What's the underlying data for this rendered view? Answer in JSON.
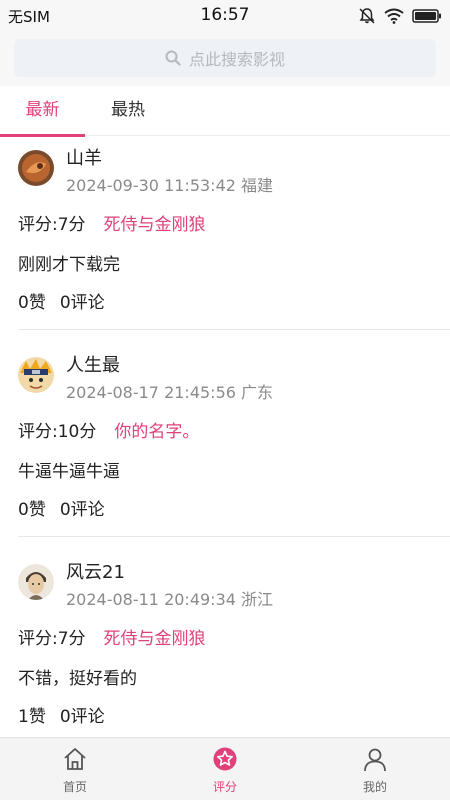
{
  "status_bar": {
    "carrier": "无SIM",
    "time": "16:57"
  },
  "search": {
    "placeholder": "点此搜索影视"
  },
  "tabs": [
    {
      "label": "最新",
      "active": true
    },
    {
      "label": "最热",
      "active": false
    }
  ],
  "posts": [
    {
      "username": "山羊",
      "datetime": "2024-09-30 11:53:42",
      "location": "福建",
      "score": "评分:7分",
      "title": "死侍与金刚狼",
      "content": "刚刚才下载完",
      "likes": "0赞",
      "comments": "0评论"
    },
    {
      "username": "人生最",
      "datetime": "2024-08-17 21:45:56",
      "location": "广东",
      "score": "评分:10分",
      "title": "你的名字。",
      "content": "牛逼牛逼牛逼",
      "likes": "0赞",
      "comments": "0评论"
    },
    {
      "username": "风云21",
      "datetime": "2024-08-11 20:49:34",
      "location": "浙江",
      "score": "评分:7分",
      "title": "死侍与金刚狼",
      "content": "不错，挺好看的",
      "likes": "1赞",
      "comments": "0评论"
    }
  ],
  "bottom_nav": [
    {
      "label": "首页",
      "icon": "home-icon",
      "active": false
    },
    {
      "label": "评分",
      "icon": "star-circle-icon",
      "active": true
    },
    {
      "label": "我的",
      "icon": "person-icon",
      "active": false
    }
  ],
  "colors": {
    "accent": "#e0417a",
    "meta_text": "#8a8a8a"
  }
}
